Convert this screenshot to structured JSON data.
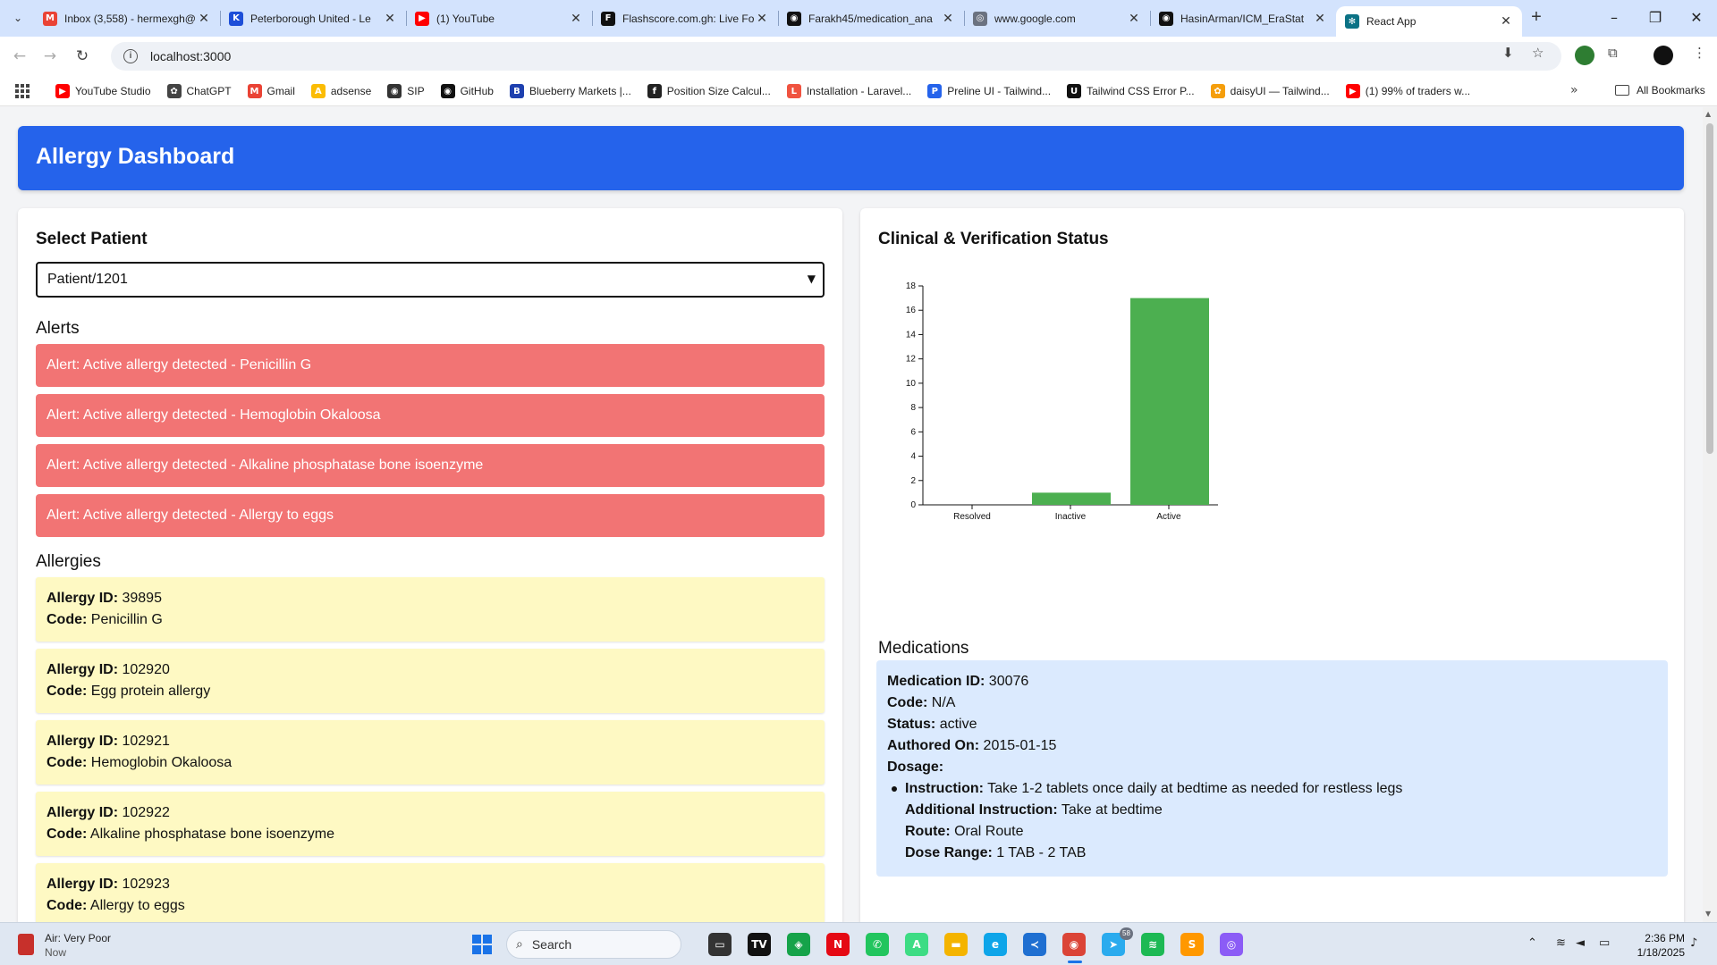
{
  "browser": {
    "tabs": [
      {
        "title": "Inbox (3,558) - hermexgh@",
        "icon": "gmail-icon",
        "icon_color": "#ea4335",
        "glyph": "M",
        "active": false
      },
      {
        "title": "Peterborough United - Le",
        "icon": "flashscore-icon",
        "icon_color": "#1d4ed8",
        "glyph": "K",
        "active": false
      },
      {
        "title": "(1) YouTube",
        "icon": "youtube-icon",
        "icon_color": "#ff0000",
        "glyph": "▶",
        "active": false
      },
      {
        "title": "Flashscore.com.gh: Live Fo",
        "icon": "flashscore-icon",
        "icon_color": "#111111",
        "glyph": "F",
        "active": false
      },
      {
        "title": "Farakh45/medication_ana",
        "icon": "github-icon",
        "icon_color": "#111111",
        "glyph": "◉",
        "active": false
      },
      {
        "title": "www.google.com",
        "icon": "globe-icon",
        "icon_color": "#6b7280",
        "glyph": "◎",
        "active": false
      },
      {
        "title": "HasinArman/ICM_EraStat",
        "icon": "github-icon",
        "icon_color": "#111111",
        "glyph": "◉",
        "active": false
      },
      {
        "title": "React App",
        "icon": "react-icon",
        "icon_color": "#0b7285",
        "glyph": "✻",
        "active": true
      }
    ],
    "url": "localhost:3000",
    "bookmarks": [
      {
        "label": "YouTube Studio",
        "icon": "youtube-studio-icon",
        "icon_color": "#ff0000",
        "glyph": "▶"
      },
      {
        "label": "ChatGPT",
        "icon": "chatgpt-icon",
        "icon_color": "#444444",
        "glyph": "✿"
      },
      {
        "label": "Gmail",
        "icon": "gmail-icon",
        "icon_color": "#ea4335",
        "glyph": "M"
      },
      {
        "label": "adsense",
        "icon": "adsense-icon",
        "icon_color": "#fbbc04",
        "glyph": "A"
      },
      {
        "label": "SIP",
        "icon": "sip-icon",
        "icon_color": "#333333",
        "glyph": "◉"
      },
      {
        "label": "GitHub",
        "icon": "github-icon",
        "icon_color": "#111111",
        "glyph": "◉"
      },
      {
        "label": "Blueberry Markets |...",
        "icon": "blueberry-icon",
        "icon_color": "#1e40af",
        "glyph": "B"
      },
      {
        "label": "Position Size Calcul...",
        "icon": "fx-icon",
        "icon_color": "#222222",
        "glyph": "f"
      },
      {
        "label": "Installation - Laravel...",
        "icon": "laravel-icon",
        "icon_color": "#f05340",
        "glyph": "L"
      },
      {
        "label": "Preline UI - Tailwind...",
        "icon": "preline-icon",
        "icon_color": "#2563eb",
        "glyph": "P"
      },
      {
        "label": "Tailwind CSS Error P...",
        "icon": "ui-icon",
        "icon_color": "#111111",
        "glyph": "U"
      },
      {
        "label": "daisyUI — Tailwind...",
        "icon": "daisyui-icon",
        "icon_color": "#f59e0b",
        "glyph": "✿"
      },
      {
        "label": "(1) 99% of traders w...",
        "icon": "youtube-icon",
        "icon_color": "#ff0000",
        "glyph": "▶"
      }
    ],
    "all_bookmarks_label": "All Bookmarks"
  },
  "app": {
    "title": "Allergy Dashboard",
    "select_patient_heading": "Select Patient",
    "selected_patient": "Patient/1201",
    "alerts_heading": "Alerts",
    "alerts": [
      "Alert: Active allergy detected - Penicillin G",
      "Alert: Active allergy detected - Hemoglobin Okaloosa",
      "Alert: Active allergy detected - Alkaline phosphatase bone isoenzyme",
      "Alert: Active allergy detected - Allergy to eggs"
    ],
    "allergies_heading": "Allergies",
    "allergy_id_label": "Allergy ID:",
    "code_label": "Code:",
    "allergies": [
      {
        "id": "39895",
        "code": "Penicillin G"
      },
      {
        "id": "102920",
        "code": "Egg protein allergy"
      },
      {
        "id": "102921",
        "code": "Hemoglobin Okaloosa"
      },
      {
        "id": "102922",
        "code": "Alkaline phosphatase bone isoenzyme"
      },
      {
        "id": "102923",
        "code": "Allergy to eggs"
      }
    ],
    "chart_heading": "Clinical & Verification Status",
    "medications_heading": "Medications",
    "medication": {
      "id_label": "Medication ID:",
      "id": "30076",
      "code_label": "Code:",
      "code": "N/A",
      "status_label": "Status:",
      "status": "active",
      "authored_label": "Authored On:",
      "authored": "2015-01-15",
      "dosage_label": "Dosage:",
      "instruction_label": "Instruction:",
      "instruction": "Take 1-2 tablets once daily at bedtime as needed for restless legs",
      "additional_label": "Additional Instruction:",
      "additional": "Take at bedtime",
      "route_label": "Route:",
      "route": "Oral Route",
      "dose_range_label": "Dose Range:",
      "dose_range": "1 TAB - 2 TAB"
    },
    "colors": {
      "header": "#2563eb",
      "alert": "#f27474",
      "allergy_card": "#fef9c3",
      "medication_card": "#dbeafe",
      "bar": "#4caf50"
    }
  },
  "chart_data": {
    "type": "bar",
    "categories": [
      "Resolved",
      "Inactive",
      "Active"
    ],
    "values": [
      0,
      1,
      17
    ],
    "title": "Clinical & Verification Status",
    "xlabel": "",
    "ylabel": "",
    "ylim": [
      0,
      18
    ],
    "yticks": [
      0,
      2,
      4,
      6,
      8,
      10,
      12,
      14,
      16,
      18
    ],
    "grid": false,
    "legend": "none",
    "bar_color": "#4caf50"
  },
  "taskbar": {
    "weather_title": "Air: Very Poor",
    "weather_sub": "Now",
    "search_placeholder": "Search",
    "apps": [
      {
        "name": "file-explorer-app-icon",
        "color": "#333333",
        "glyph": "▭"
      },
      {
        "name": "tradingview-app-icon",
        "color": "#111111",
        "glyph": "TV"
      },
      {
        "name": "android-app-icon",
        "color": "#16a34a",
        "glyph": "◈"
      },
      {
        "name": "netflix-app-icon",
        "color": "#e50914",
        "glyph": "N"
      },
      {
        "name": "whatsapp-app-icon",
        "color": "#22c55e",
        "glyph": "✆"
      },
      {
        "name": "android-studio-app-icon",
        "color": "#3ddc84",
        "glyph": "A"
      },
      {
        "name": "folder-app-icon",
        "color": "#f4b400",
        "glyph": "▬"
      },
      {
        "name": "edge-app-icon",
        "color": "#0ea5e9",
        "glyph": "e"
      },
      {
        "name": "vscode-app-icon",
        "color": "#1f6fd1",
        "glyph": "≺"
      },
      {
        "name": "chrome-app-icon",
        "color": "#db4437",
        "glyph": "◉"
      },
      {
        "name": "telegram-app-icon",
        "color": "#2aabee",
        "glyph": "➤"
      },
      {
        "name": "spotify-app-icon",
        "color": "#1db954",
        "glyph": "≋"
      },
      {
        "name": "sublime-app-icon",
        "color": "#ff9800",
        "glyph": "S"
      },
      {
        "name": "podcast-app-icon",
        "color": "#8b5cf6",
        "glyph": "◎"
      }
    ],
    "telegram_badge": "58",
    "time": "2:36 PM",
    "date": "1/18/2025"
  }
}
